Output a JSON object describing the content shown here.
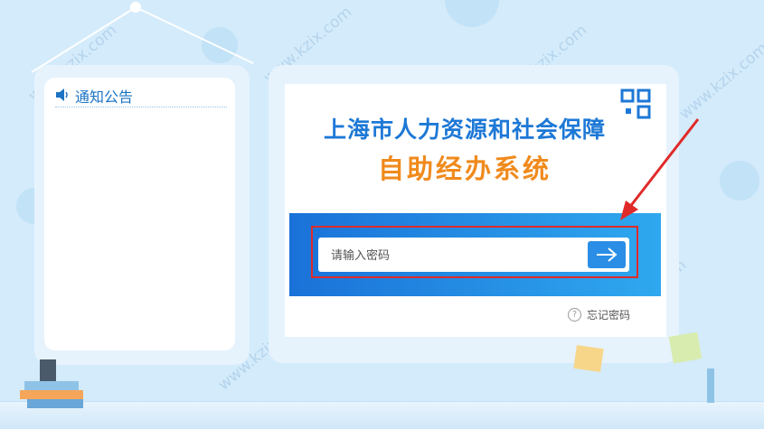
{
  "notice": {
    "title": "通知公告"
  },
  "system": {
    "title_main": "上海市人力资源和社会保障",
    "title_sub": "自助经办系统"
  },
  "login": {
    "password_placeholder": "请输入密码",
    "forgot_label": "忘记密码"
  },
  "watermark": {
    "text": "www.kzix.com"
  },
  "colors": {
    "brand_blue": "#1d78d6",
    "brand_orange": "#f08a1c",
    "annotation_red": "#e02a2a"
  }
}
